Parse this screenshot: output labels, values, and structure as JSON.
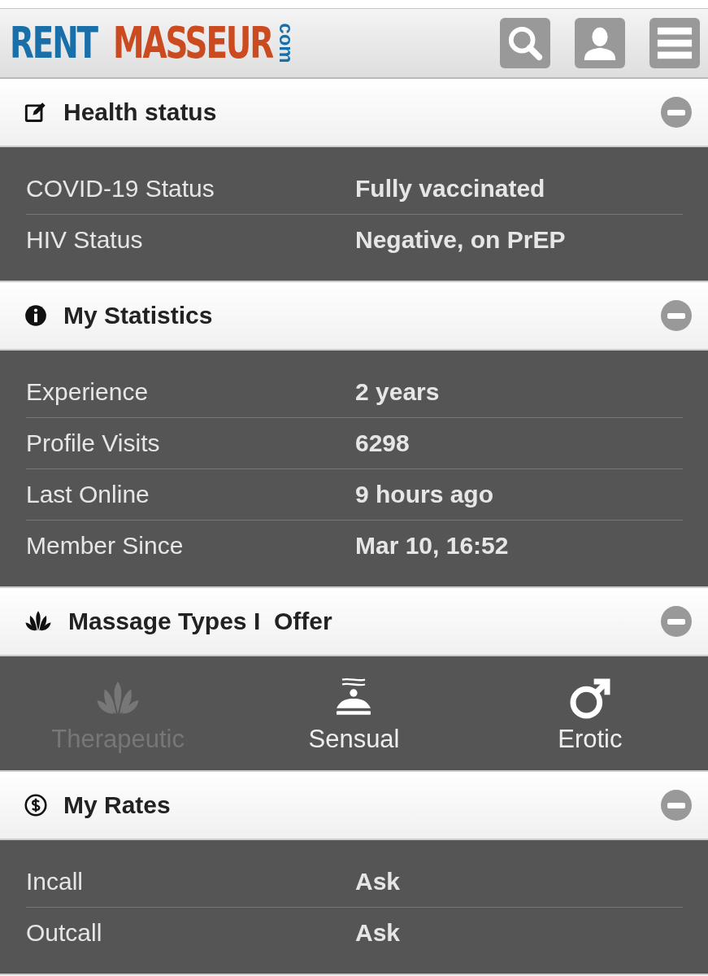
{
  "logo": {
    "part_1": "RENT",
    "part_2": "MASSEUR",
    "part_3": "com"
  },
  "sections": [
    {
      "kind": "rows",
      "title": "Health status",
      "expanded": true,
      "rows": [
        {
          "label": "COVID-19 Status",
          "value": "Fully vaccinated"
        },
        {
          "label": "HIV Status",
          "value": "Negative, on PrEP"
        }
      ]
    },
    {
      "kind": "rows",
      "title": "My Statistics",
      "expanded": true,
      "rows": [
        {
          "label": "Experience",
          "value": "2 years"
        },
        {
          "label": "Profile Visits",
          "value": "6298"
        },
        {
          "label": "Last Online",
          "value": "9 hours ago"
        },
        {
          "label": "Member Since",
          "value": "Mar 10, 16:52"
        }
      ]
    },
    {
      "kind": "types",
      "title": "Massage Types I  Offer",
      "expanded": true,
      "types": [
        {
          "label": "Therapeutic",
          "offered": false
        },
        {
          "label": "Sensual",
          "offered": true
        },
        {
          "label": "Erotic",
          "offered": true
        }
      ]
    },
    {
      "kind": "rows",
      "title": "My Rates",
      "expanded": true,
      "rows": [
        {
          "label": "Incall",
          "value": "Ask"
        },
        {
          "label": "Outcall",
          "value": "Ask"
        }
      ]
    }
  ]
}
